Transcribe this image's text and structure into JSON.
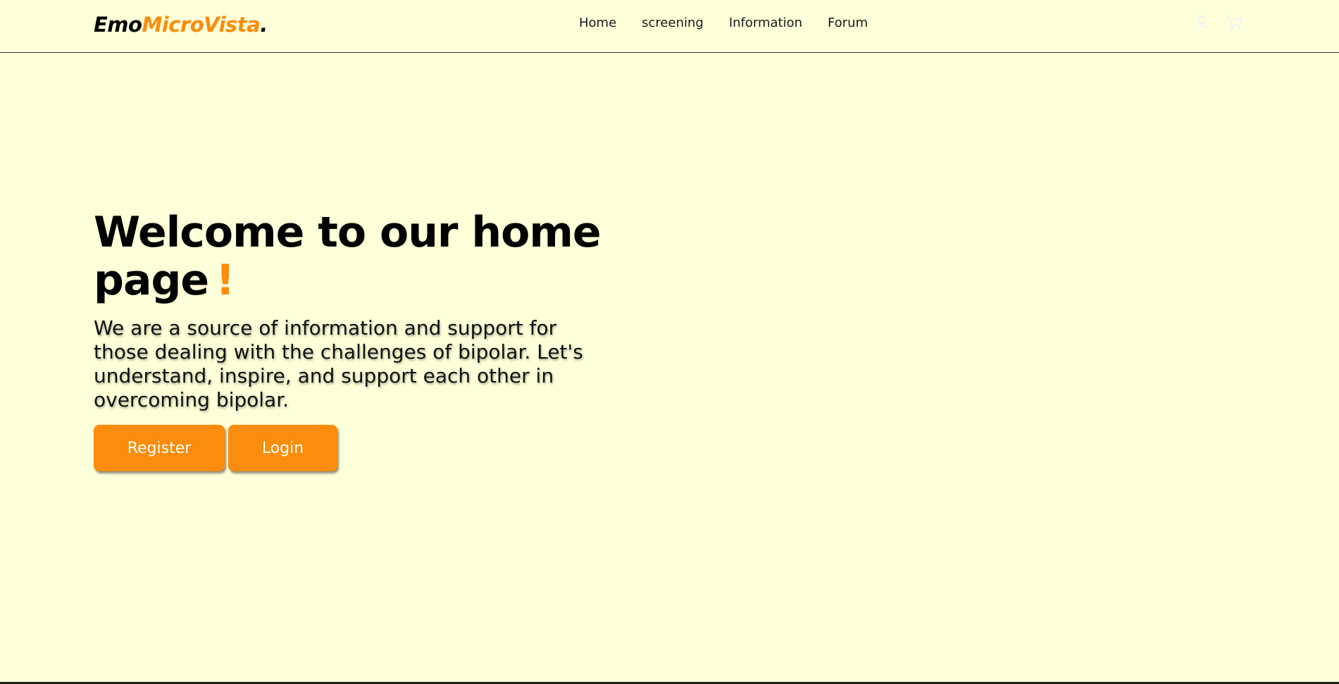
{
  "brand": {
    "part1": "Emo",
    "part2": "MicroVista",
    "part3": "."
  },
  "nav": {
    "items": [
      {
        "label": "Home"
      },
      {
        "label": "screening"
      },
      {
        "label": "Information"
      },
      {
        "label": "Forum"
      }
    ]
  },
  "header_icons": {
    "user_icon": "user-icon",
    "cart_icon": "cart-icon"
  },
  "hero": {
    "title": "Welcome to our home page",
    "title_accent": "!",
    "description": "We are a source of information and support for those dealing with the challenges of bipolar. Let's understand, inspire, and support each other in overcoming bipolar."
  },
  "actions": {
    "register_label": "Register",
    "login_label": "Login"
  },
  "colors": {
    "background": "#ffffd9",
    "accent": "#fc8c0b",
    "text": "#000000"
  }
}
